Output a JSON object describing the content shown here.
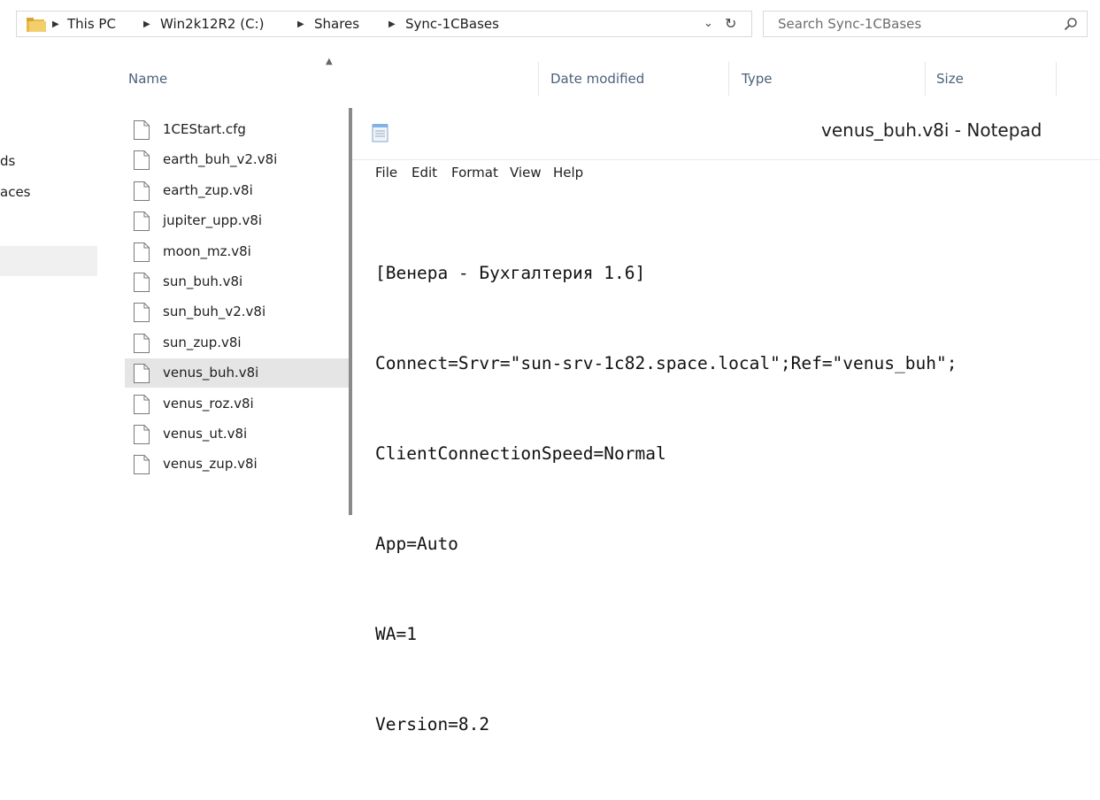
{
  "address": {
    "crumbs": [
      "This PC",
      "Win2k12R2 (C:)",
      "Shares",
      "Sync-1CBases"
    ]
  },
  "search": {
    "placeholder": "Search Sync-1CBases"
  },
  "columns": {
    "name": "Name",
    "date_modified": "Date modified",
    "type": "Type",
    "size": "Size"
  },
  "nav_pane": {
    "item1": "ds",
    "item2": "aces"
  },
  "files": [
    "1CEStart.cfg",
    "earth_buh_v2.v8i",
    "earth_zup.v8i",
    "jupiter_upp.v8i",
    "moon_mz.v8i",
    "sun_buh.v8i",
    "sun_buh_v2.v8i",
    "sun_zup.v8i",
    "venus_buh.v8i",
    "venus_roz.v8i",
    "venus_ut.v8i",
    "venus_zup.v8i"
  ],
  "selected_file": "venus_buh.v8i",
  "notepad": {
    "title": "venus_buh.v8i - Notepad",
    "menu": [
      "File",
      "Edit",
      "Format",
      "View",
      "Help"
    ],
    "lines": [
      "[Венера - Бухгалтерия 1.6]",
      "Connect=Srvr=\"sun-srv-1c82.space.local\";Ref=\"venus_buh\";",
      "ClientConnectionSpeed=Normal",
      "App=Auto",
      "WA=1",
      "Version=8.2"
    ]
  }
}
